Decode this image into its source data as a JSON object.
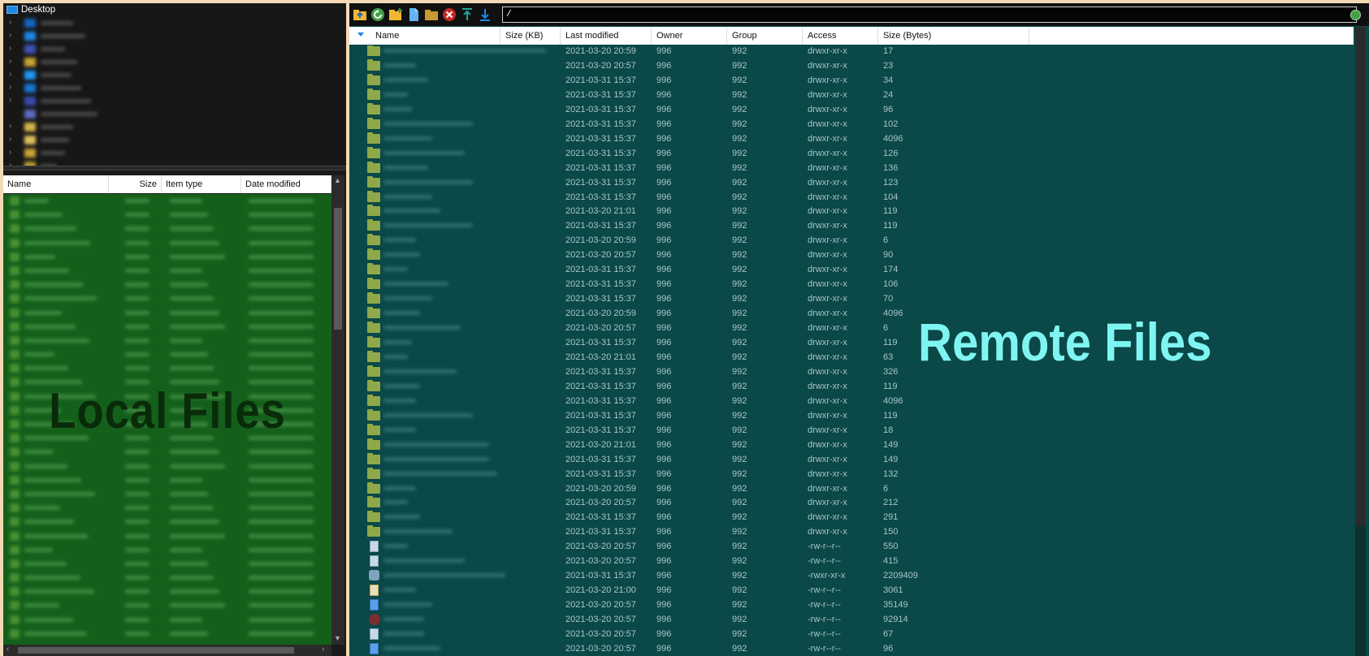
{
  "local": {
    "tree_root_label": "Desktop",
    "watermark": "Local Files",
    "columns": [
      "Name",
      "Size",
      "Item type",
      "Date modified"
    ]
  },
  "remote": {
    "path": "/",
    "watermark": "Remote Files",
    "columns": [
      "Name",
      "Size (KB)",
      "Last modified",
      "Owner",
      "Group",
      "Access",
      "Size (Bytes)"
    ],
    "rows": [
      {
        "icon": "folder",
        "modified": "2021-03-20 20:59",
        "owner": "996",
        "group": "992",
        "access": "drwxr-xr-x",
        "bytes": "17"
      },
      {
        "icon": "folder",
        "modified": "2021-03-20 20:57",
        "owner": "996",
        "group": "992",
        "access": "drwxr-xr-x",
        "bytes": "23"
      },
      {
        "icon": "folder",
        "modified": "2021-03-31 15:37",
        "owner": "996",
        "group": "992",
        "access": "drwxr-xr-x",
        "bytes": "34"
      },
      {
        "icon": "folder",
        "modified": "2021-03-31 15:37",
        "owner": "996",
        "group": "992",
        "access": "drwxr-xr-x",
        "bytes": "24"
      },
      {
        "icon": "folder",
        "modified": "2021-03-31 15:37",
        "owner": "996",
        "group": "992",
        "access": "drwxr-xr-x",
        "bytes": "96"
      },
      {
        "icon": "folder",
        "modified": "2021-03-31 15:37",
        "owner": "996",
        "group": "992",
        "access": "drwxr-xr-x",
        "bytes": "102"
      },
      {
        "icon": "folder",
        "modified": "2021-03-31 15:37",
        "owner": "996",
        "group": "992",
        "access": "drwxr-xr-x",
        "bytes": "4096"
      },
      {
        "icon": "folder",
        "modified": "2021-03-31 15:37",
        "owner": "996",
        "group": "992",
        "access": "drwxr-xr-x",
        "bytes": "126"
      },
      {
        "icon": "folder",
        "modified": "2021-03-31 15:37",
        "owner": "996",
        "group": "992",
        "access": "drwxr-xr-x",
        "bytes": "136"
      },
      {
        "icon": "folder",
        "modified": "2021-03-31 15:37",
        "owner": "996",
        "group": "992",
        "access": "drwxr-xr-x",
        "bytes": "123"
      },
      {
        "icon": "folder",
        "modified": "2021-03-31 15:37",
        "owner": "996",
        "group": "992",
        "access": "drwxr-xr-x",
        "bytes": "104"
      },
      {
        "icon": "folder",
        "modified": "2021-03-20 21:01",
        "owner": "996",
        "group": "992",
        "access": "drwxr-xr-x",
        "bytes": "119"
      },
      {
        "icon": "folder",
        "modified": "2021-03-31 15:37",
        "owner": "996",
        "group": "992",
        "access": "drwxr-xr-x",
        "bytes": "119"
      },
      {
        "icon": "folder",
        "modified": "2021-03-20 20:59",
        "owner": "996",
        "group": "992",
        "access": "drwxr-xr-x",
        "bytes": "6"
      },
      {
        "icon": "folder",
        "modified": "2021-03-20 20:57",
        "owner": "996",
        "group": "992",
        "access": "drwxr-xr-x",
        "bytes": "90"
      },
      {
        "icon": "folder",
        "modified": "2021-03-31 15:37",
        "owner": "996",
        "group": "992",
        "access": "drwxr-xr-x",
        "bytes": "174"
      },
      {
        "icon": "folder",
        "modified": "2021-03-31 15:37",
        "owner": "996",
        "group": "992",
        "access": "drwxr-xr-x",
        "bytes": "106"
      },
      {
        "icon": "folder",
        "modified": "2021-03-31 15:37",
        "owner": "996",
        "group": "992",
        "access": "drwxr-xr-x",
        "bytes": "70"
      },
      {
        "icon": "folder",
        "modified": "2021-03-20 20:59",
        "owner": "996",
        "group": "992",
        "access": "drwxr-xr-x",
        "bytes": "4096"
      },
      {
        "icon": "folder",
        "modified": "2021-03-20 20:57",
        "owner": "996",
        "group": "992",
        "access": "drwxr-xr-x",
        "bytes": "6"
      },
      {
        "icon": "folder",
        "modified": "2021-03-31 15:37",
        "owner": "996",
        "group": "992",
        "access": "drwxr-xr-x",
        "bytes": "119"
      },
      {
        "icon": "folder",
        "modified": "2021-03-20 21:01",
        "owner": "996",
        "group": "992",
        "access": "drwxr-xr-x",
        "bytes": "63"
      },
      {
        "icon": "folder",
        "modified": "2021-03-31 15:37",
        "owner": "996",
        "group": "992",
        "access": "drwxr-xr-x",
        "bytes": "326"
      },
      {
        "icon": "folder",
        "modified": "2021-03-31 15:37",
        "owner": "996",
        "group": "992",
        "access": "drwxr-xr-x",
        "bytes": "119"
      },
      {
        "icon": "folder",
        "modified": "2021-03-31 15:37",
        "owner": "996",
        "group": "992",
        "access": "drwxr-xr-x",
        "bytes": "4096"
      },
      {
        "icon": "folder",
        "modified": "2021-03-31 15:37",
        "owner": "996",
        "group": "992",
        "access": "drwxr-xr-x",
        "bytes": "119"
      },
      {
        "icon": "folder",
        "modified": "2021-03-31 15:37",
        "owner": "996",
        "group": "992",
        "access": "drwxr-xr-x",
        "bytes": "18"
      },
      {
        "icon": "folder",
        "modified": "2021-03-20 21:01",
        "owner": "996",
        "group": "992",
        "access": "drwxr-xr-x",
        "bytes": "149"
      },
      {
        "icon": "folder",
        "modified": "2021-03-31 15:37",
        "owner": "996",
        "group": "992",
        "access": "drwxr-xr-x",
        "bytes": "149"
      },
      {
        "icon": "folder",
        "modified": "2021-03-31 15:37",
        "owner": "996",
        "group": "992",
        "access": "drwxr-xr-x",
        "bytes": "132"
      },
      {
        "icon": "folder",
        "modified": "2021-03-20 20:59",
        "owner": "996",
        "group": "992",
        "access": "drwxr-xr-x",
        "bytes": "6"
      },
      {
        "icon": "folder",
        "modified": "2021-03-20 20:57",
        "owner": "996",
        "group": "992",
        "access": "drwxr-xr-x",
        "bytes": "212"
      },
      {
        "icon": "folder",
        "modified": "2021-03-31 15:37",
        "owner": "996",
        "group": "992",
        "access": "drwxr-xr-x",
        "bytes": "291"
      },
      {
        "icon": "folder",
        "modified": "2021-03-31 15:37",
        "owner": "996",
        "group": "992",
        "access": "drwxr-xr-x",
        "bytes": "150"
      },
      {
        "icon": "file",
        "modified": "2021-03-20 20:57",
        "owner": "996",
        "group": "992",
        "access": "-rw-r--r--",
        "bytes": "550"
      },
      {
        "icon": "file",
        "modified": "2021-03-20 20:57",
        "owner": "996",
        "group": "992",
        "access": "-rw-r--r--",
        "bytes": "415"
      },
      {
        "icon": "exe",
        "modified": "2021-03-31 15:37",
        "owner": "996",
        "group": "992",
        "access": "-rwxr-xr-x",
        "bytes": "2209409"
      },
      {
        "icon": "script",
        "modified": "2021-03-20 21:00",
        "owner": "996",
        "group": "992",
        "access": "-rw-r--r--",
        "bytes": "3061"
      },
      {
        "icon": "doc",
        "modified": "2021-03-20 20:57",
        "owner": "996",
        "group": "992",
        "access": "-rw-r--r--",
        "bytes": "35149"
      },
      {
        "icon": "bug",
        "modified": "2021-03-20 20:57",
        "owner": "996",
        "group": "992",
        "access": "-rw-r--r--",
        "bytes": "92914"
      },
      {
        "icon": "file",
        "modified": "2021-03-20 20:57",
        "owner": "996",
        "group": "992",
        "access": "-rw-r--r--",
        "bytes": "67"
      },
      {
        "icon": "doc",
        "modified": "2021-03-20 20:57",
        "owner": "996",
        "group": "992",
        "access": "-rw-r--r--",
        "bytes": "96"
      }
    ]
  },
  "toolbar": {
    "buttons": [
      "parent-folder-icon",
      "refresh-icon",
      "new-folder-icon",
      "new-file-icon",
      "open-folder-icon",
      "delete-icon",
      "upload-icon",
      "download-icon"
    ]
  },
  "colors": {
    "local_bg": "#14601b",
    "remote_bg": "#0b4848",
    "remote_watermark": "#7ff5f2",
    "local_watermark": "#0a2b0a"
  }
}
